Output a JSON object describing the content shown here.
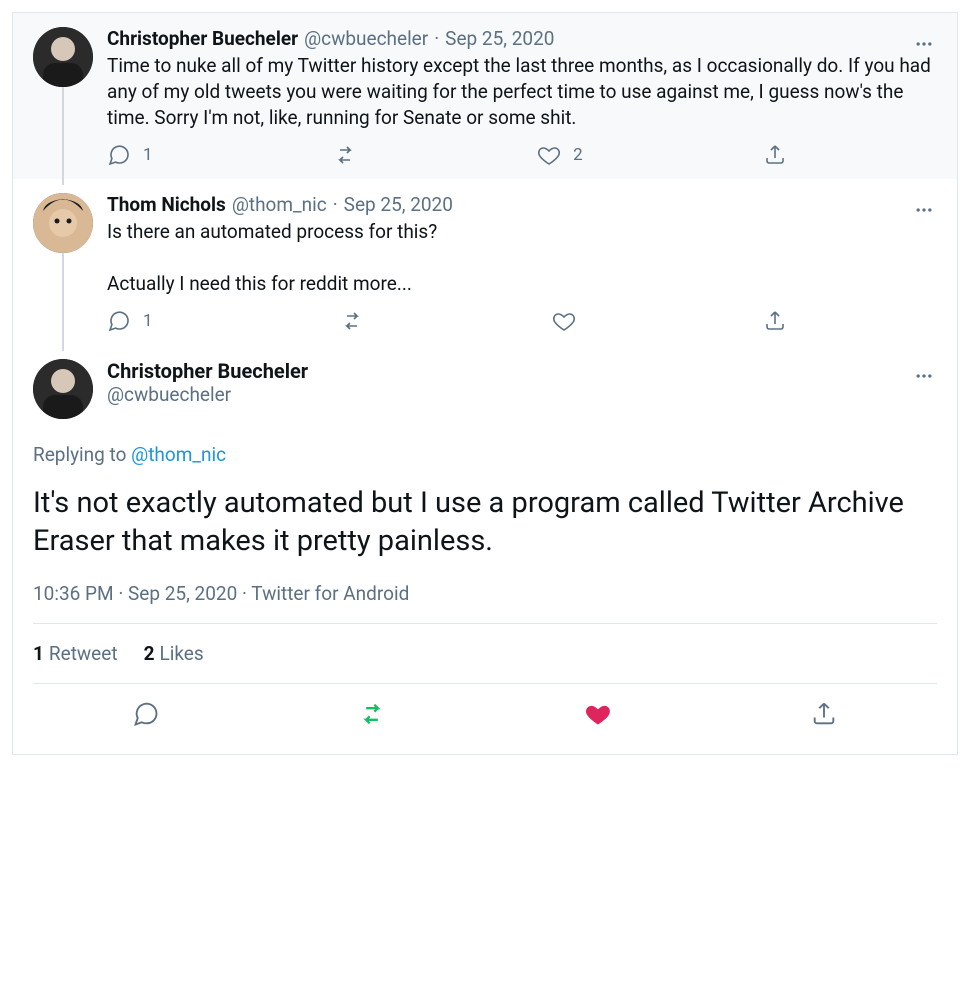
{
  "thread": [
    {
      "display_name": "Christopher Buecheler",
      "handle": "@cwbuecheler",
      "date": "Sep 25, 2020",
      "text": "Time to nuke all of my Twitter history except the last three months, as I occasionally do. If you had any of my old tweets you were waiting for the perfect time to use against me, I guess now's the time. Sorry I'm not, like, running for Senate or some shit.",
      "reply_count": "1",
      "like_count": "2"
    },
    {
      "display_name": "Thom Nichols",
      "handle": "@thom_nic",
      "date": "Sep 25, 2020",
      "text": "Is there an automated process for this?\n\nActually I need this for reddit more...",
      "reply_count": "1",
      "like_count": ""
    }
  ],
  "main": {
    "display_name": "Christopher Buecheler",
    "handle": "@cwbuecheler",
    "replying_label": "Replying to ",
    "replying_handle": "@thom_nic",
    "text": "It's not exactly automated but I use a program called Twitter Archive Eraser that makes it pretty painless.",
    "time": "10:36 PM",
    "date": "Sep 25, 2020",
    "source": "Twitter for Android",
    "retweets_count": "1",
    "retweets_label": "Retweet",
    "likes_count": "2",
    "likes_label": "Likes"
  },
  "sep": " · "
}
